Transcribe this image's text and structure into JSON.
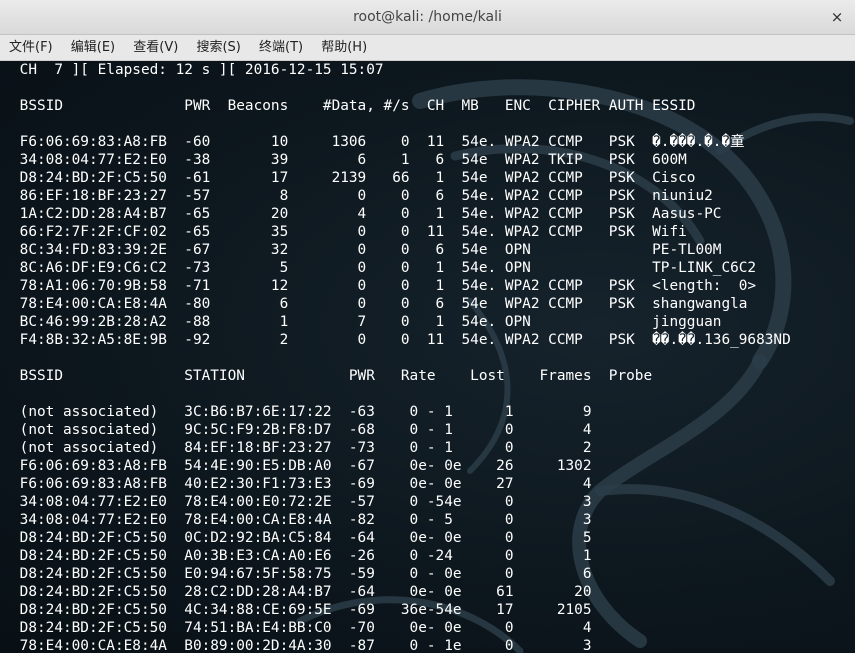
{
  "window": {
    "title": "root@kali: /home/kali",
    "close_glyph": "×"
  },
  "menu": [
    "文件(F)",
    "编辑(E)",
    "查看(V)",
    "搜索(S)",
    "终端(T)",
    "帮助(H)"
  ],
  "terminal": {
    "lines": [
      " CH  7 ][ Elapsed: 12 s ][ 2016-12-15 15:07",
      "",
      " BSSID              PWR  Beacons    #Data, #/s  CH  MB   ENC  CIPHER AUTH ESSID",
      "",
      " F6:06:69:83:A8:FB  -60       10     1306    0  11  54e. WPA2 CCMP   PSK  �.���.�.�童",
      " 34:08:04:77:E2:E0  -38       39        6    1   6  54e  WPA2 TKIP   PSK  600M",
      " D8:24:BD:2F:C5:50  -61       17     2139   66   1  54e  WPA2 CCMP   PSK  Cisco",
      " 86:EF:18:BF:23:27  -57        8        0    0   6  54e. WPA2 CCMP   PSK  niuniu2",
      " 1A:C2:DD:28:A4:B7  -65       20        4    0   1  54e. WPA2 CCMP   PSK  Aasus-PC",
      " 66:F2:7F:2F:CF:02  -65       35        0    0  11  54e. WPA2 CCMP   PSK  Wifi",
      " 8C:34:FD:83:39:2E  -67       32        0    0   6  54e  OPN              PE-TL00M",
      " 8C:A6:DF:E9:C6:C2  -73        5        0    0   1  54e. OPN              TP-LINK_C6C2",
      " 78:A1:06:70:9B:58  -71       12        0    0   1  54e. WPA2 CCMP   PSK  <length:  0>",
      " 78:E4:00:CA:E8:4A  -80        6        0    0   6  54e  WPA2 CCMP   PSK  shangwangla",
      " BC:46:99:2B:28:A2  -88        1        7    0   1  54e. OPN              jingguan",
      " F4:8B:32:A5:8E:9B  -92        2        0    0  11  54e. WPA2 CCMP   PSK  ��.��.136_9683ND",
      "",
      " BSSID              STATION            PWR   Rate    Lost    Frames  Probe",
      "",
      " (not associated)   3C:B6:B7:6E:17:22  -63    0 - 1      1        9",
      " (not associated)   9C:5C:F9:2B:F8:D7  -68    0 - 1      0        4",
      " (not associated)   84:EF:18:BF:23:27  -73    0 - 1      0        2",
      " F6:06:69:83:A8:FB  54:4E:90:E5:DB:A0  -67    0e- 0e    26     1302",
      " F6:06:69:83:A8:FB  40:E2:30:F1:73:E3  -69    0e- 0e    27        4",
      " 34:08:04:77:E2:E0  78:E4:00:E0:72:2E  -57    0 -54e     0        3",
      " 34:08:04:77:E2:E0  78:E4:00:CA:E8:4A  -82    0 - 5      0        3",
      " D8:24:BD:2F:C5:50  0C:D2:92:BA:C5:84  -64    0e- 0e     0        5",
      " D8:24:BD:2F:C5:50  A0:3B:E3:CA:A0:E6  -26    0 -24      0        1",
      " D8:24:BD:2F:C5:50  E0:94:67:5F:58:75  -59    0 - 0e     0        6",
      " D8:24:BD:2F:C5:50  28:C2:DD:28:A4:B7  -64    0e- 0e    61       20",
      " D8:24:BD:2F:C5:50  4C:34:88:CE:69:5E  -69   36e-54e    17     2105",
      " D8:24:BD:2F:C5:50  74:51:BA:E4:BB:C0  -70    0e- 0e     0        4",
      " 78:E4:00:CA:E8:4A  B0:89:00:2D:4A:30  -87    0 - 1e     0        3"
    ]
  }
}
